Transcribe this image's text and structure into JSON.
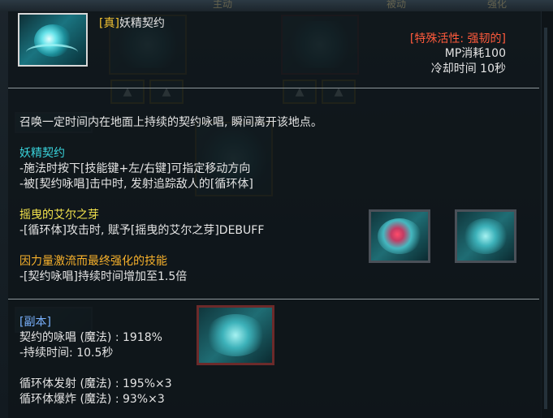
{
  "background": {
    "top_tabs": [
      "主动",
      "被动",
      "强化"
    ],
    "faded_label": "上一级"
  },
  "skill": {
    "tag": "[真]",
    "name": "妖精契约",
    "special_trait": "[特殊活性: 强韧的]",
    "mp_cost": "MP消耗100",
    "cooldown": "冷却时间 10秒"
  },
  "description": "召唤一定时间内在地面上持续的契约咏唱, 瞬间离开该地点。",
  "sections": [
    {
      "title": "妖精契约",
      "lines": [
        "-施法时按下[技能键+左/右键]可指定移动方向",
        "-被[契约咏唱]击中时, 发射追踪敌人的[循环体]"
      ]
    },
    {
      "title": "摇曳的艾尔之芽",
      "lines": [
        "-[循环体]攻击时, 赋予[摇曳的艾尔之芽]DEBUFF"
      ]
    },
    {
      "title": "因力量激流而最终强化的技能",
      "lines": [
        "-[契约咏唱]持续时间增加至1.5倍"
      ]
    }
  ],
  "dungeon": {
    "header": "[副本]",
    "lines": [
      "契约的咏唱 (魔法) : 1918%",
      "-持续时间: 10.5秒",
      "",
      "循环体发射 (魔法) : 195%×3",
      "循环体爆炸 (魔法) : 93%×3"
    ]
  },
  "icons": {
    "main": "fairy-contract-skill-icon",
    "bg_slots": "skill-slot-icon",
    "flower": "elbud-icon",
    "swirl": "loop-body-icon",
    "arrow_up": "arrow-up-icon"
  },
  "colors": {
    "gold_heading": "#f4c332",
    "cyan_heading": "#39d3db",
    "special_red": "#ff5a3c",
    "dungeon_blue": "#7ab2ff",
    "body_text": "#e4e4e4",
    "separator": "#8d969a"
  }
}
